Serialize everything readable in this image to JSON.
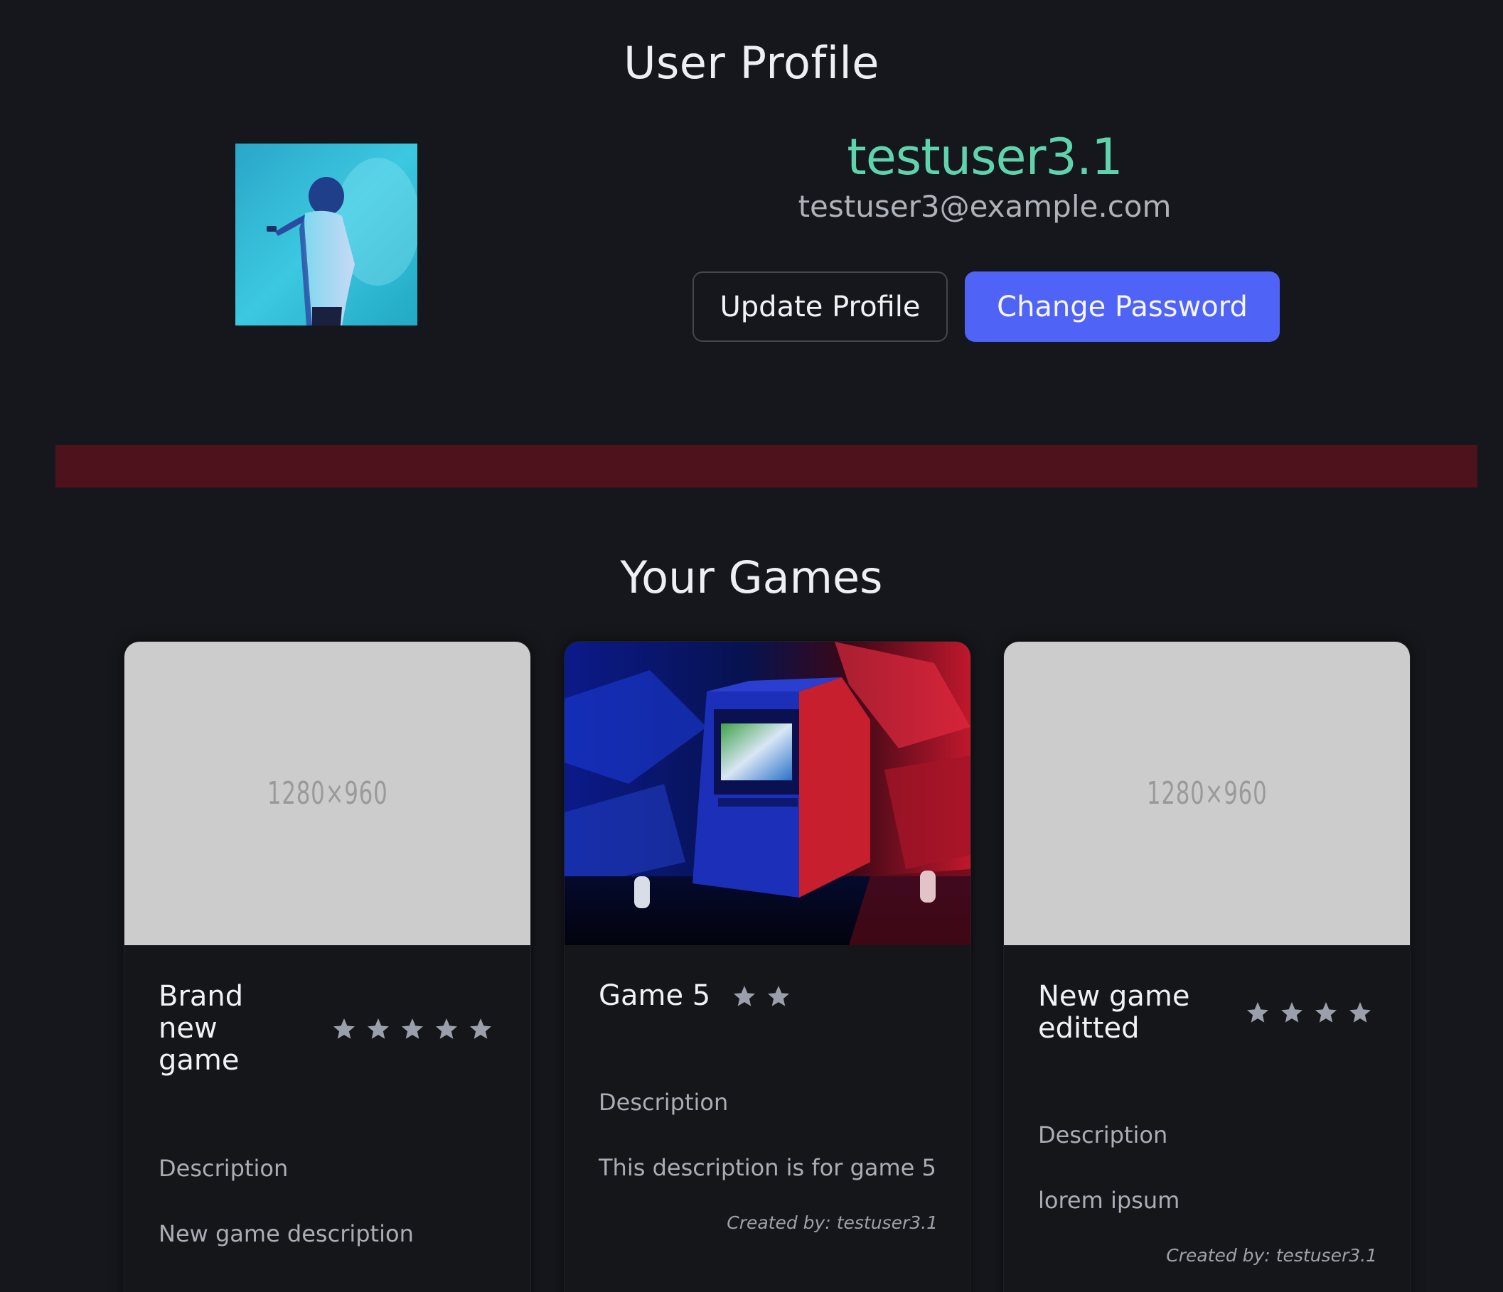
{
  "page": {
    "title": "User Profile"
  },
  "profile": {
    "username": "testuser3.1",
    "email": "testuser3@example.com",
    "update_label": "Update Profile",
    "password_label": "Change Password"
  },
  "games_section": {
    "title": "Your Games"
  },
  "games": [
    {
      "title": "Brand new game",
      "rating": 5,
      "image": "1280×960",
      "description_label": "Description",
      "description": "New game description",
      "created_by": ""
    },
    {
      "title": "Game 5",
      "rating": 2,
      "image": "arcade-photo",
      "description_label": "Description",
      "description": "This description is for game 5",
      "created_by": "Created by: testuser3.1"
    },
    {
      "title": "New game editted",
      "rating": 4,
      "image": "1280×960",
      "description_label": "Description",
      "description": "lorem ipsum",
      "created_by": "Created by: testuser3.1"
    }
  ],
  "colors": {
    "background": "#16171c",
    "username": "#5fd4ac",
    "primary_button": "#4f63f6",
    "alert_bar": "#4e121c",
    "star": "#9aa0ab"
  }
}
